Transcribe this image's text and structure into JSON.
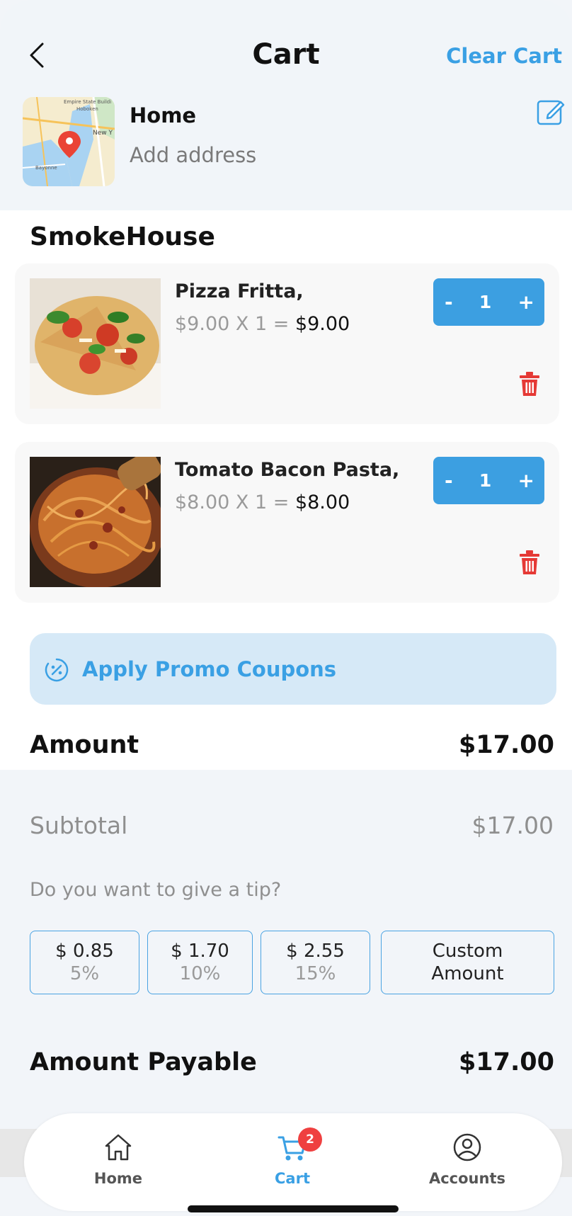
{
  "header": {
    "title": "Cart",
    "clear_label": "Clear Cart"
  },
  "address": {
    "title": "Home",
    "subtitle": "Add address",
    "map_labels": [
      "Empire State Buildi",
      "Hoboken",
      "New Y",
      "Bayonne"
    ]
  },
  "restaurant": {
    "name": "SmokeHouse"
  },
  "items": [
    {
      "name": "Pizza Fritta,",
      "unit_price": "$9.00 X 1 =",
      "total": "$9.00",
      "quantity": "1",
      "minus": "-",
      "plus": "+"
    },
    {
      "name": "Tomato Bacon Pasta,",
      "unit_price": "$8.00 X 1 =",
      "total": "$8.00",
      "quantity": "1",
      "minus": "-",
      "plus": "+"
    }
  ],
  "promo": {
    "label": "Apply Promo Coupons"
  },
  "amount": {
    "label": "Amount",
    "value": "$17.00"
  },
  "summary": {
    "subtotal_label": "Subtotal",
    "subtotal_value": "$17.00",
    "tip_question": "Do you want to give a tip?",
    "tips": [
      {
        "amount": "$ 0.85",
        "percent": "5%"
      },
      {
        "amount": "$ 1.70",
        "percent": "10%"
      },
      {
        "amount": "$ 2.55",
        "percent": "15%"
      },
      {
        "amount": "Custom",
        "percent": "Amount"
      }
    ],
    "payable_label": "Amount Payable",
    "payable_value": "$17.00"
  },
  "nav": {
    "items": [
      {
        "label": "Home",
        "icon": "home-icon"
      },
      {
        "label": "Cart",
        "icon": "cart-icon",
        "badge": "2",
        "active": true
      },
      {
        "label": "Accounts",
        "icon": "account-icon"
      }
    ]
  },
  "colors": {
    "accent": "#3aa0e4",
    "danger": "#e53935",
    "badge": "#ef4040",
    "promo_bg": "#d6e9f7"
  }
}
